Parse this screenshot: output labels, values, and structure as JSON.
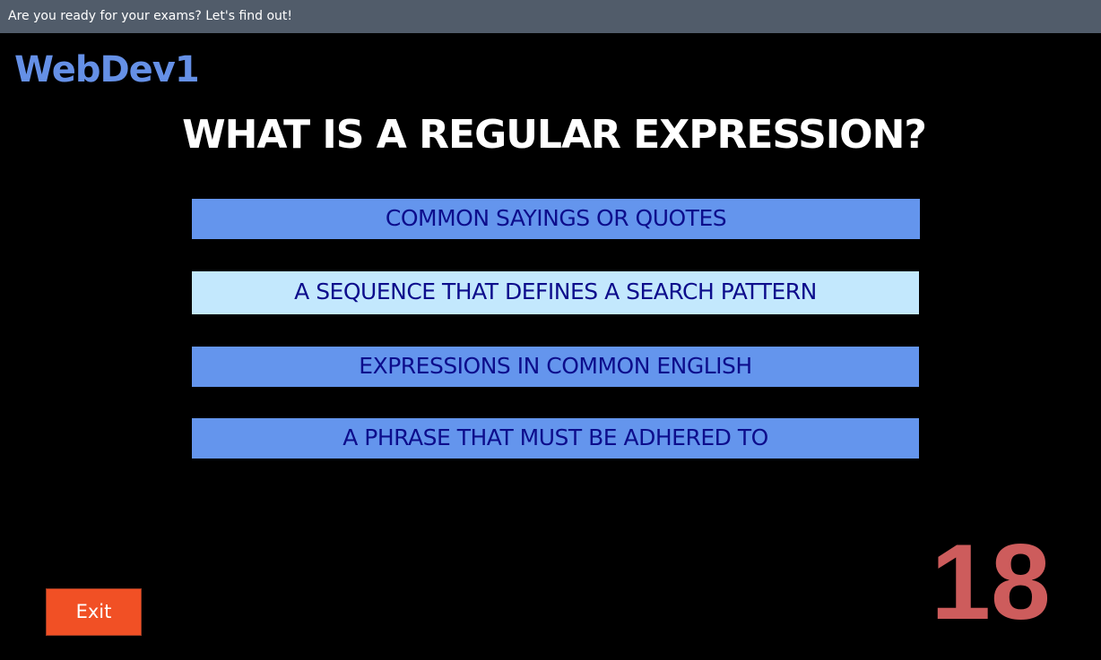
{
  "window": {
    "title": "Are you ready for your exams? Let's find out!"
  },
  "app": {
    "logo_text": "WebDev1",
    "question": "WHAT IS A REGULAR EXPRESSION?",
    "answers": [
      {
        "label": "COMMON SAYINGS OR QUOTES",
        "selected": false
      },
      {
        "label": "A SEQUENCE THAT DEFINES A SEARCH PATTERN",
        "selected": true
      },
      {
        "label": "EXPRESSIONS IN COMMON ENGLISH",
        "selected": false
      },
      {
        "label": "A PHRASE THAT MUST BE ADHERED TO",
        "selected": false
      }
    ],
    "exit_label": "Exit",
    "timer_value": "18"
  },
  "colors": {
    "background": "#000000",
    "titlebar": "#515c6a",
    "logo": "#6590e6",
    "answer_bg": "#6495ed",
    "answer_selected_bg": "#c3e8fd",
    "answer_text": "#0d0d8c",
    "exit_button": "#f15025",
    "timer": "#cd5c5c"
  }
}
